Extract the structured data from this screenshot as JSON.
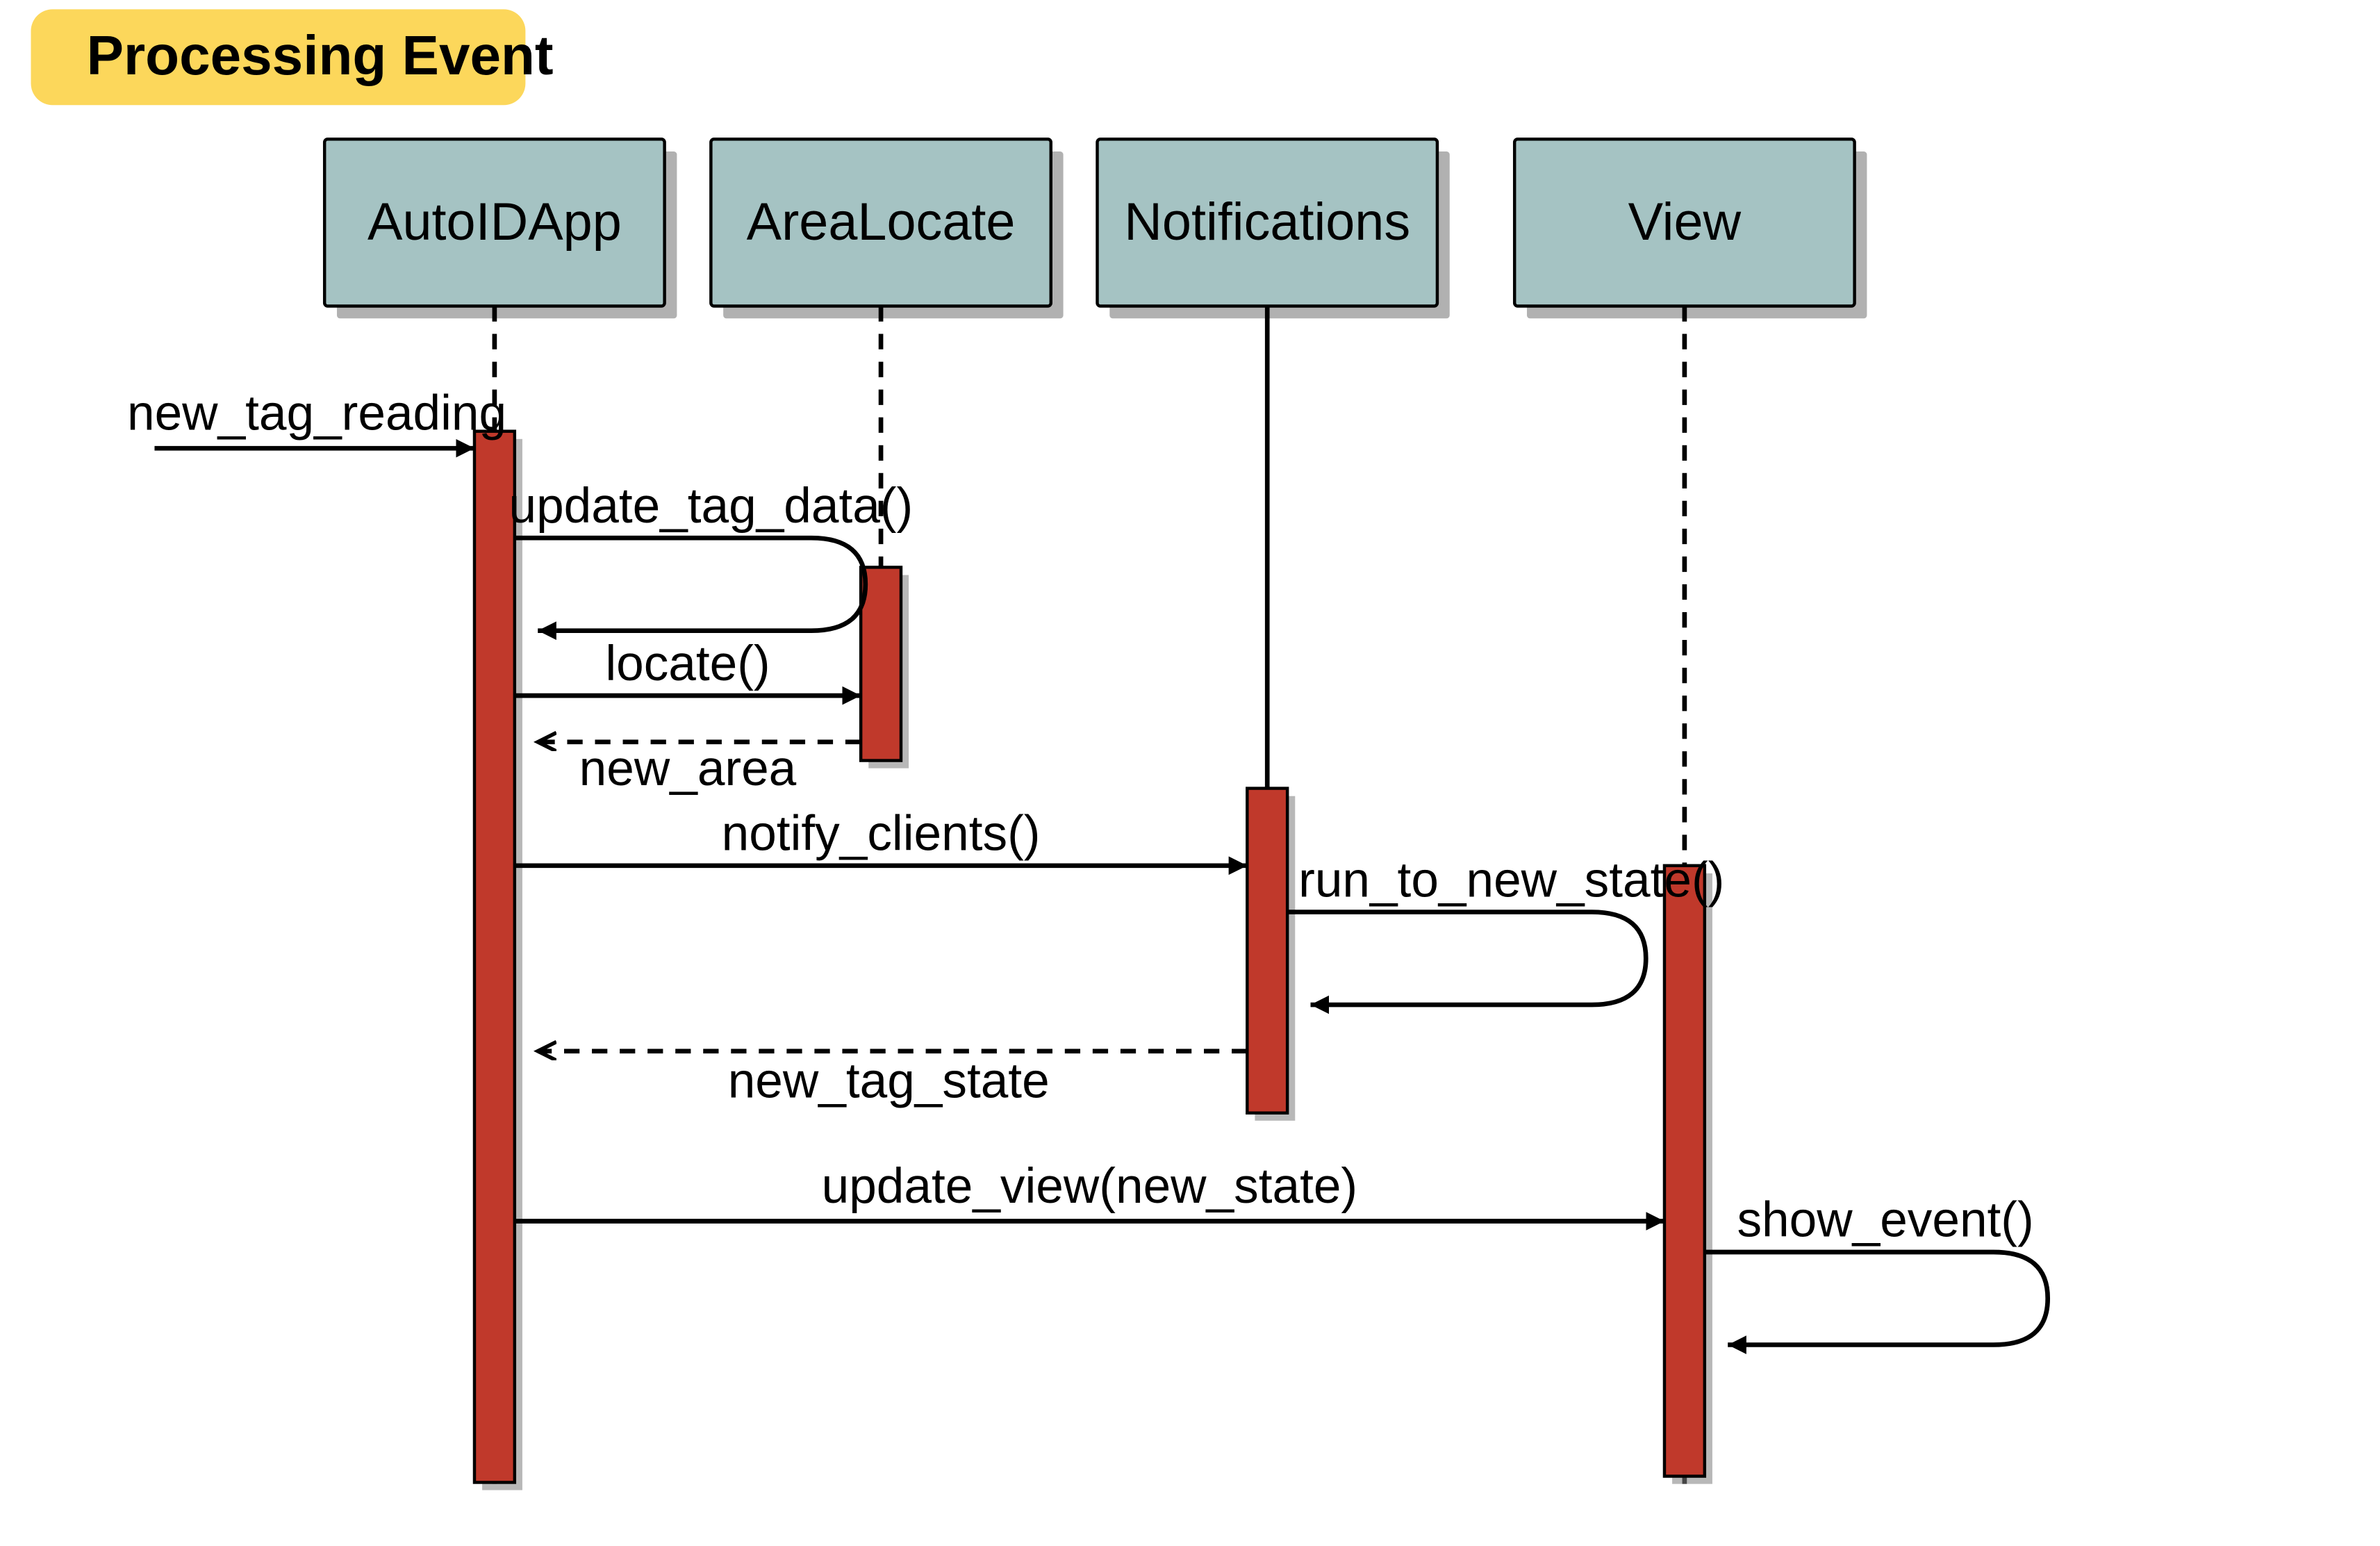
{
  "title": "Processing Event",
  "colors": {
    "title_bg": "#fcd75b",
    "participant_bg": "#a5c3c3",
    "activation_bg": "#c0392b"
  },
  "participants": [
    {
      "id": "autoidapp",
      "label": "AutoIDApp",
      "lifeline_style": "dashed"
    },
    {
      "id": "arealocate",
      "label": "AreaLocate",
      "lifeline_style": "dashed"
    },
    {
      "id": "notifications",
      "label": "Notifications",
      "lifeline_style": "solid"
    },
    {
      "id": "view",
      "label": "View",
      "lifeline_style": "dashed"
    }
  ],
  "messages": {
    "incoming": "new_tag_reading",
    "update_tag_data": "update_tag_data()",
    "locate": "locate()",
    "new_area": "new_area",
    "notify_clients": "notify_clients()",
    "run_to_new": "run_to_new_state()",
    "new_tag_state": "new_tag_state",
    "update_view": "update_view(new_state)",
    "show_event": "show_event()"
  }
}
